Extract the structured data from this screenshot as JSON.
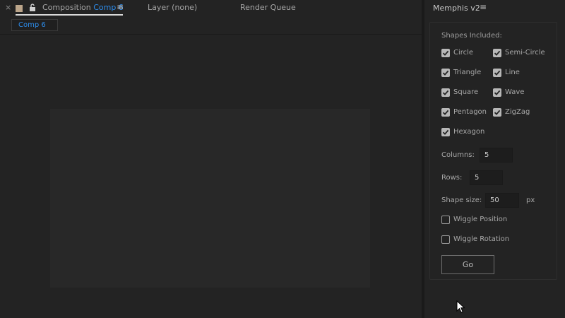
{
  "tabs": {
    "close": "×",
    "composition_prefix": "Composition",
    "composition_name": "Comp 6",
    "menu": "≡",
    "layer": "Layer  (none)",
    "render_queue": "Render Queue"
  },
  "subbar": {
    "comp_chip": "Comp 6"
  },
  "panel": {
    "title": "Memphis v2",
    "menu": "≡",
    "shapes_included": "Shapes Included:",
    "shapes": [
      {
        "label": "Circle",
        "checked": true
      },
      {
        "label": "Semi-Circle",
        "checked": true
      },
      {
        "label": "Triangle",
        "checked": true
      },
      {
        "label": "Line",
        "checked": true
      },
      {
        "label": "Square",
        "checked": true
      },
      {
        "label": "Wave",
        "checked": true
      },
      {
        "label": "Pentagon",
        "checked": true
      },
      {
        "label": "ZigZag",
        "checked": true
      },
      {
        "label": "Hexagon",
        "checked": true
      }
    ],
    "columns_label": "Columns:",
    "columns_value": "5",
    "rows_label": "Rows:",
    "rows_value": "5",
    "shape_size_label": "Shape size:",
    "shape_size_value": "50",
    "shape_size_unit": "px",
    "wiggle_position": {
      "label": "Wiggle Position",
      "checked": false
    },
    "wiggle_rotation": {
      "label": "Wiggle Rotation",
      "checked": false
    },
    "go_label": "Go"
  },
  "colors": {
    "accent": "#2d8ceb",
    "background": "#232323",
    "canvas": "#282828",
    "swatch": "#bba58a"
  }
}
